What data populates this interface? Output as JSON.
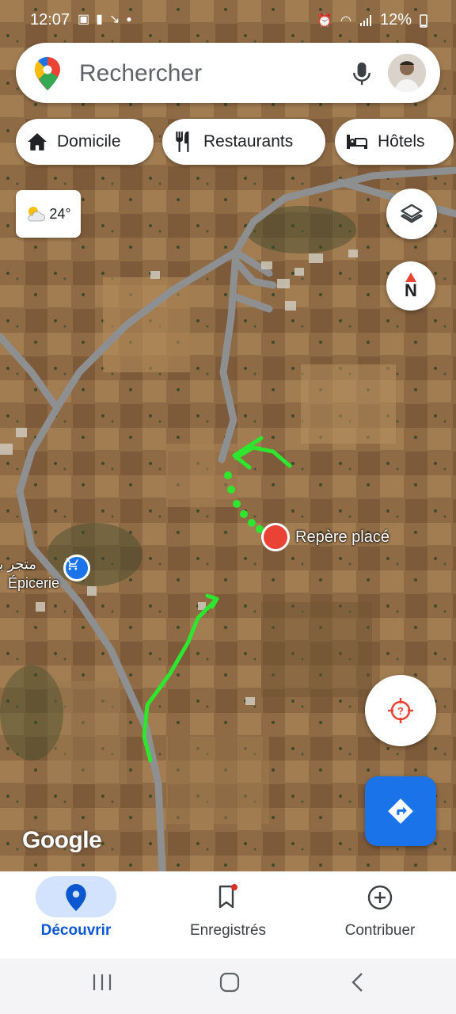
{
  "status_bar": {
    "time": "12:07",
    "battery": "12%",
    "icons": [
      "photo-icon",
      "alert-icon",
      "missed-call-icon",
      "dot-icon",
      "alarm-icon",
      "wifi-icon",
      "signal-icon",
      "battery-icon"
    ]
  },
  "search": {
    "placeholder": "Rechercher"
  },
  "chips": [
    {
      "label": "Domicile",
      "icon": "home-icon"
    },
    {
      "label": "Restaurants",
      "icon": "restaurant-icon"
    },
    {
      "label": "Hôtels",
      "icon": "hotel-icon"
    }
  ],
  "weather": {
    "temperature": "24°",
    "icon": "partly-cloudy-icon"
  },
  "map": {
    "pin_label": "Repère placé",
    "store_label_ar": "متجر بقالة",
    "store_label": "Épicerie",
    "watermark": "Google",
    "compass_letter": "N"
  },
  "bottom_nav": [
    {
      "label": "Découvrir",
      "icon": "location-pin-icon",
      "active": true
    },
    {
      "label": "Enregistrés",
      "icon": "bookmark-icon",
      "active": false
    },
    {
      "label": "Contribuer",
      "icon": "add-circle-icon",
      "active": false
    }
  ],
  "colors": {
    "accent": "#1a73e8",
    "active_nav_bg": "#d3e3fd",
    "pin": "#ea4335",
    "annotation": "#2ee62e"
  }
}
